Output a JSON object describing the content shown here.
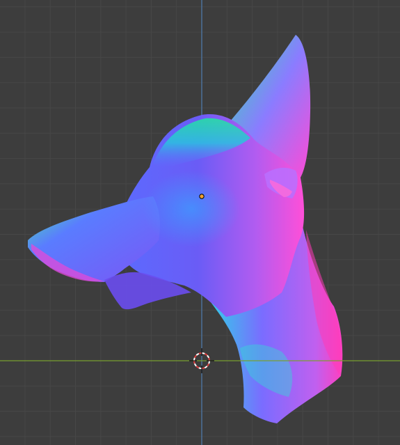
{
  "viewport": {
    "background_color": "#3d3d3d",
    "grid_minor_color": "#474747",
    "grid_major_color": "#515151",
    "x_axis_color": "#7a9e30",
    "y_axis_color": "#4e79a8",
    "show_grid": true,
    "show_axes": true
  },
  "object": {
    "shading": "normal-map",
    "selected": true,
    "origin_color": "#f0a030"
  },
  "cursor_3d": {
    "visible": true,
    "ring_colors": [
      "#e04040",
      "#ffffff"
    ]
  }
}
